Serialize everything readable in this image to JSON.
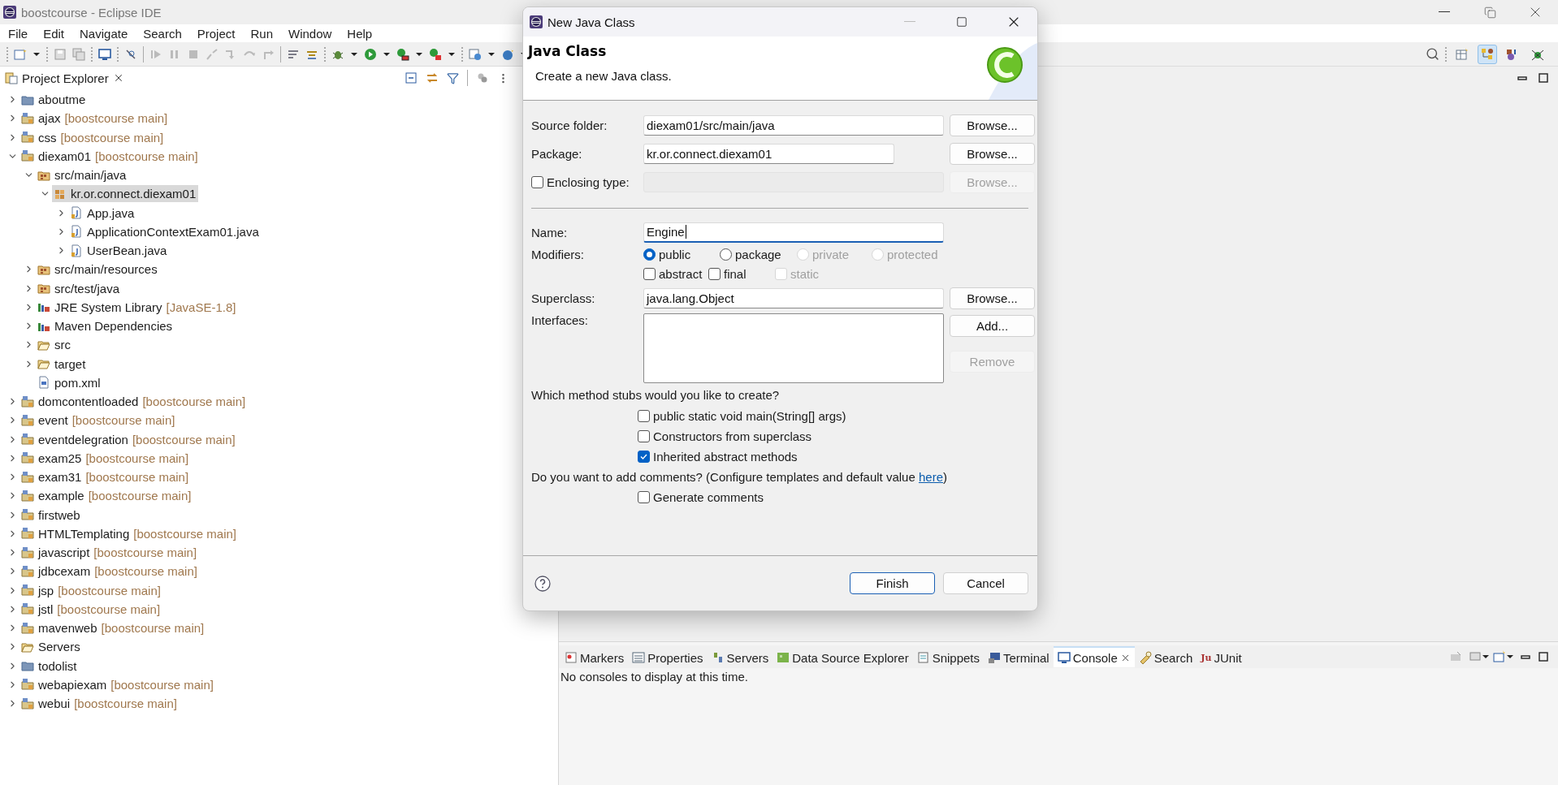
{
  "window": {
    "title": "boostcourse - Eclipse IDE"
  },
  "menu": [
    "File",
    "Edit",
    "Navigate",
    "Search",
    "Project",
    "Run",
    "Window",
    "Help"
  ],
  "perspective_buttons": [
    {
      "selected": false
    },
    {
      "selected": true
    },
    {
      "selected": false
    },
    {
      "selected": false
    }
  ],
  "project_explorer": {
    "title": "Project Explorer",
    "tree": [
      {
        "label": "aboutme",
        "kind": "closed-project",
        "expanded": false,
        "selected": false
      },
      {
        "label": "ajax",
        "decoration": "[boostcourse main]",
        "kind": "project",
        "expanded": false,
        "selected": false
      },
      {
        "label": "css",
        "decoration": "[boostcourse main]",
        "kind": "project",
        "expanded": false,
        "selected": false
      },
      {
        "label": "diexam01",
        "decoration": "[boostcourse main]",
        "kind": "project",
        "expanded": true,
        "selected": false,
        "children": [
          {
            "label": "src/main/java",
            "kind": "source-folder",
            "expanded": true,
            "selected": false,
            "children": [
              {
                "label": "kr.or.connect.diexam01",
                "kind": "package",
                "expanded": true,
                "selected": true,
                "children": [
                  {
                    "label": "App.java",
                    "kind": "java-file",
                    "expanded": false,
                    "selected": false
                  },
                  {
                    "label": "ApplicationContextExam01.java",
                    "kind": "java-file",
                    "expanded": false,
                    "selected": false
                  },
                  {
                    "label": "UserBean.java",
                    "kind": "java-file",
                    "expanded": false,
                    "selected": false
                  }
                ]
              }
            ]
          },
          {
            "label": "src/main/resources",
            "kind": "source-folder",
            "expanded": false,
            "selected": false
          },
          {
            "label": "src/test/java",
            "kind": "source-folder",
            "expanded": false,
            "selected": false
          },
          {
            "label": "JRE System Library",
            "decoration": "[JavaSE-1.8]",
            "kind": "library",
            "expanded": false,
            "selected": false
          },
          {
            "label": "Maven Dependencies",
            "kind": "library",
            "expanded": false,
            "selected": false
          },
          {
            "label": "src",
            "kind": "folder",
            "expanded": false,
            "selected": false
          },
          {
            "label": "target",
            "kind": "folder",
            "expanded": false,
            "selected": false
          },
          {
            "label": "pom.xml",
            "kind": "xml-file",
            "selected": false
          }
        ]
      },
      {
        "label": "domcontentloaded",
        "decoration": "[boostcourse main]",
        "kind": "project",
        "expanded": false,
        "selected": false
      },
      {
        "label": "event",
        "decoration": "[boostcourse main]",
        "kind": "project",
        "expanded": false,
        "selected": false
      },
      {
        "label": "eventdelegration",
        "decoration": "[boostcourse main]",
        "kind": "project",
        "expanded": false,
        "selected": false
      },
      {
        "label": "exam25",
        "decoration": "[boostcourse main]",
        "kind": "project",
        "expanded": false,
        "selected": false
      },
      {
        "label": "exam31",
        "decoration": "[boostcourse main]",
        "kind": "project",
        "expanded": false,
        "selected": false
      },
      {
        "label": "example",
        "decoration": "[boostcourse main]",
        "kind": "project",
        "expanded": false,
        "selected": false
      },
      {
        "label": "firstweb",
        "kind": "project",
        "expanded": false,
        "selected": false
      },
      {
        "label": "HTMLTemplating",
        "decoration": "[boostcourse main]",
        "kind": "project",
        "expanded": false,
        "selected": false
      },
      {
        "label": "javascript",
        "decoration": "[boostcourse main]",
        "kind": "project",
        "expanded": false,
        "selected": false
      },
      {
        "label": "jdbcexam",
        "decoration": "[boostcourse main]",
        "kind": "project",
        "expanded": false,
        "selected": false
      },
      {
        "label": "jsp",
        "decoration": "[boostcourse main]",
        "kind": "project",
        "expanded": false,
        "selected": false
      },
      {
        "label": "jstl",
        "decoration": "[boostcourse main]",
        "kind": "project",
        "expanded": false,
        "selected": false
      },
      {
        "label": "mavenweb",
        "decoration": "[boostcourse main]",
        "kind": "project",
        "expanded": false,
        "selected": false
      },
      {
        "label": "Servers",
        "kind": "folder",
        "expanded": false,
        "selected": false
      },
      {
        "label": "todolist",
        "kind": "closed-project",
        "expanded": false,
        "selected": false
      },
      {
        "label": "webapiexam",
        "decoration": "[boostcourse main]",
        "kind": "project",
        "expanded": false,
        "selected": false
      },
      {
        "label": "webui",
        "decoration": "[boostcourse main]",
        "kind": "project",
        "expanded": false,
        "selected": false
      }
    ]
  },
  "bottom_panel": {
    "tabs": [
      {
        "label": "Markers",
        "selected": false
      },
      {
        "label": "Properties",
        "selected": false
      },
      {
        "label": "Servers",
        "selected": false
      },
      {
        "label": "Data Source Explorer",
        "selected": false
      },
      {
        "label": "Snippets",
        "selected": false
      },
      {
        "label": "Terminal",
        "selected": false
      },
      {
        "label": "Console",
        "selected": true
      },
      {
        "label": "Search",
        "selected": false
      },
      {
        "label": "JUnit",
        "selected": false,
        "icon_text": "Ju"
      }
    ],
    "message": "No consoles to display at this time."
  },
  "dialog": {
    "title": "New Java Class",
    "heading": "Java Class",
    "description": "Create a new Java class.",
    "source_folder": {
      "label": "Source folder:",
      "value": "diexam01/src/main/java",
      "button": "Browse..."
    },
    "package": {
      "label": "Package:",
      "value": "kr.or.connect.diexam01",
      "button": "Browse..."
    },
    "enclosing_type": {
      "label": "Enclosing type:",
      "checked": false,
      "disabled": true,
      "button": "Browse..."
    },
    "name": {
      "label": "Name:",
      "value": "Engine",
      "focused": true
    },
    "modifiers": {
      "label": "Modifiers:",
      "access": [
        {
          "label": "public",
          "selected": true,
          "disabled": false
        },
        {
          "label": "package",
          "selected": false,
          "disabled": false
        },
        {
          "label": "private",
          "selected": false,
          "disabled": true
        },
        {
          "label": "protected",
          "selected": false,
          "disabled": true
        }
      ],
      "flags": [
        {
          "label": "abstract",
          "checked": false,
          "disabled": false
        },
        {
          "label": "final",
          "checked": false,
          "disabled": false
        },
        {
          "label": "static",
          "checked": false,
          "disabled": true
        }
      ]
    },
    "superclass": {
      "label": "Superclass:",
      "value": "java.lang.Object",
      "button": "Browse..."
    },
    "interfaces": {
      "label": "Interfaces:",
      "buttons": [
        {
          "label": "Add...",
          "disabled": false
        },
        {
          "label": "Remove",
          "disabled": true
        }
      ]
    },
    "stubs": {
      "question": "Which method stubs would you like to create?",
      "options": [
        {
          "label": "public static void main(String[] args)",
          "checked": false
        },
        {
          "label": "Constructors from superclass",
          "checked": false
        },
        {
          "label": "Inherited abstract methods",
          "checked": true
        }
      ]
    },
    "comments": {
      "question_start": "Do you want to add comments? (Configure templates and default value ",
      "link": "here",
      "question_end": ")",
      "options": [
        {
          "label": "Generate comments",
          "checked": false
        }
      ]
    },
    "buttons": [
      {
        "label": "Finish",
        "default": true
      },
      {
        "label": "Cancel",
        "default": false
      }
    ]
  }
}
